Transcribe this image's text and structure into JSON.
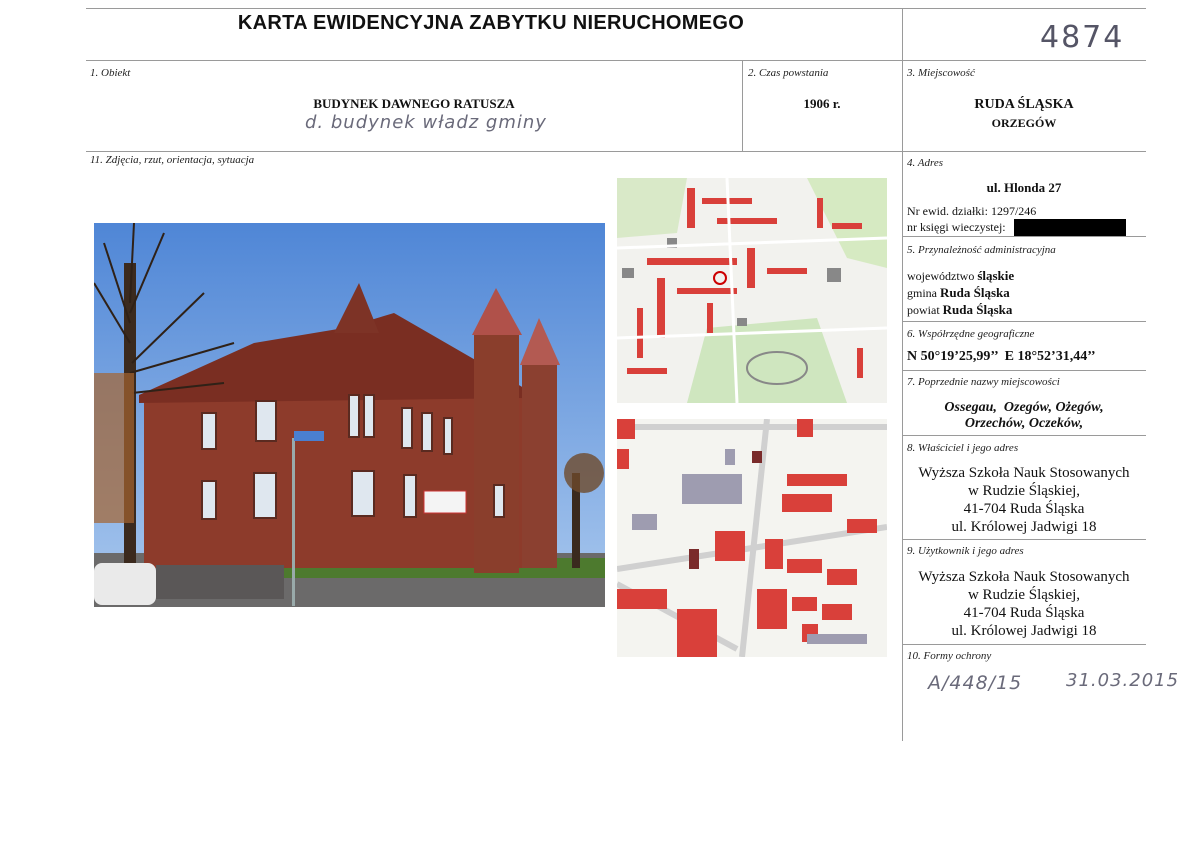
{
  "header": {
    "title": "KARTA EWIDENCYJNA ZABYTKU NIERUCHOMEGO",
    "number": "4874"
  },
  "obiekt": {
    "label": "1. Obiekt",
    "name": "BUDYNEK DAWNEGO RATUSZA",
    "handwritten": "d. budynek władz gminy"
  },
  "czas": {
    "label": "2. Czas powstania",
    "value": "1906 r."
  },
  "miejscowosc": {
    "label": "3. Miejscowość",
    "city": "RUDA ŚLĄSKA",
    "district": "ORZEGÓW"
  },
  "zdjecia": {
    "label": "11. Zdjęcia, rzut, orientacja, sytuacja"
  },
  "adres": {
    "label": "4. Adres",
    "street": "ul. Hlonda 27",
    "parcel": "Nr ewid. działki: 1297/246",
    "ledger": "nr księgi wieczystej:"
  },
  "administracja": {
    "label": "5. Przynależność administracyjna",
    "woj_prefix": "województwo ",
    "woj": "śląskie",
    "gmina_prefix": "gmina ",
    "gmina": "Ruda Śląska",
    "powiat_prefix": "powiat ",
    "powiat": "Ruda Śląska"
  },
  "wspolrzedne": {
    "label": "6. Współrzędne geograficzne",
    "value": "N 50°19’25,99’’  E 18°52’31,44’’"
  },
  "poprzednie": {
    "label": "7. Poprzednie nazwy miejscowości",
    "line1": "Ossegau,  Ozegów, Ożegów,",
    "line2": "Orzechów, Oczeków,"
  },
  "wlasciciel": {
    "label": "8. Właściciel i jego adres",
    "lines": [
      "Wyższa Szkoła Nauk Stosowanych",
      "w Rudzie Śląskiej,",
      "41-704 Ruda Śląska",
      "ul. Królowej Jadwigi 18"
    ]
  },
  "uzytkownik": {
    "label": "9. Użytkownik i jego adres",
    "lines": [
      "Wyższa Szkoła Nauk Stosowanych",
      "w Rudzie Śląskiej,",
      "41-704 Ruda Śląska",
      "ul. Królowej Jadwigi 18"
    ]
  },
  "ochrona": {
    "label": "10. Formy ochrony",
    "register": "A/448/15",
    "date": "31.03.2015"
  },
  "colors": {
    "brick": "#8a3a2a",
    "sky": "#5b8fd6",
    "map_building": "#d9403a"
  }
}
